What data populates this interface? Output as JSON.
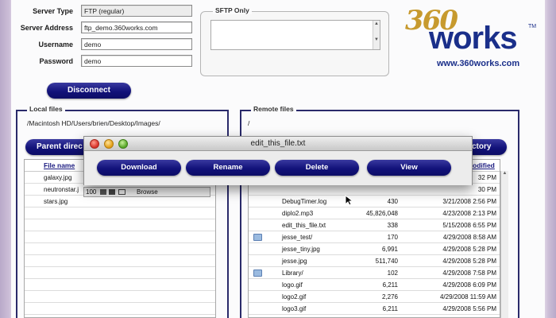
{
  "server": {
    "type_label": "Server Type",
    "type_value": "FTP (regular)",
    "address_label": "Server Address",
    "address_value": "ftp_demo.360works.com",
    "username_label": "Username",
    "username_value": "demo",
    "password_label": "Password",
    "password_value": "demo"
  },
  "sftp": {
    "title": "SFTP Only"
  },
  "logo": {
    "brand_number": "360",
    "brand_word": "works",
    "tm": "TM",
    "url": "www.360works.com"
  },
  "buttons": {
    "disconnect": "Disconnect",
    "parent_dir": "Parent direc",
    "directory": "ctory"
  },
  "local": {
    "title": "Local files",
    "path": "/Macintosh HD/Users/brien/Desktop/Images/",
    "column": "File name",
    "files": [
      "galaxy.jpg",
      "neutronstar.j",
      "stars.jpg"
    ]
  },
  "remote": {
    "title": "Remote files",
    "path": "/",
    "header_modified": "odified",
    "rows": [
      {
        "name": "",
        "size": "",
        "date": "32 PM",
        "folder": false
      },
      {
        "name": "",
        "size": "",
        "date": "30 PM",
        "folder": false
      },
      {
        "name": "DebugTimer.log",
        "size": "430",
        "date": "3/21/2008 2:56 PM",
        "folder": false
      },
      {
        "name": "diplo2.mp3",
        "size": "45,826,048",
        "date": "4/23/2008 2:13 PM",
        "folder": false
      },
      {
        "name": "edit_this_file.txt",
        "size": "338",
        "date": "5/15/2008 6:55 PM",
        "folder": false
      },
      {
        "name": "jesse_test/",
        "size": "170",
        "date": "4/29/2008 8:58 AM",
        "folder": true
      },
      {
        "name": "jesse_tiny.jpg",
        "size": "6,991",
        "date": "4/29/2008 5:28 PM",
        "folder": false
      },
      {
        "name": "jesse.jpg",
        "size": "511,740",
        "date": "4/29/2008 5:28 PM",
        "folder": false
      },
      {
        "name": "Library/",
        "size": "102",
        "date": "4/29/2008 7:58 PM",
        "folder": true
      },
      {
        "name": "logo.gif",
        "size": "6,211",
        "date": "4/29/2008 6:09 PM",
        "folder": false
      },
      {
        "name": "logo2.gif",
        "size": "2,276",
        "date": "4/29/2008 11:59 AM",
        "folder": false
      },
      {
        "name": "logo3.gif",
        "size": "6,211",
        "date": "4/29/2008 5:56 PM",
        "folder": false
      }
    ]
  },
  "dialog": {
    "title": "edit_this_file.txt",
    "buttons": [
      "Download",
      "Rename",
      "Delete",
      "View"
    ]
  },
  "embed": {
    "zoom": "100",
    "browse": "Browse"
  },
  "colors": {
    "button_navy": "#12127a",
    "logo_gold": "#c79a2e",
    "logo_navy": "#1a2f8a"
  }
}
